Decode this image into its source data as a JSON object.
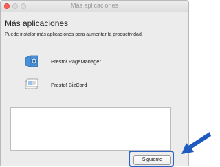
{
  "window": {
    "title": "Más aplicaciones"
  },
  "heading": "Más aplicaciones",
  "subtitle": "Puede instalar más aplicaciones para aumentar la productividad.",
  "apps": [
    {
      "name": "Presto! PageManager",
      "icon": "pagemanager-icon"
    },
    {
      "name": "Presto! BizCard",
      "icon": "bizcard-icon"
    }
  ],
  "buttons": {
    "next_label": "Siguiente"
  },
  "colors": {
    "highlight": "#2a64c8",
    "arrow": "#1f5bbf",
    "close": "#fb5f57"
  }
}
